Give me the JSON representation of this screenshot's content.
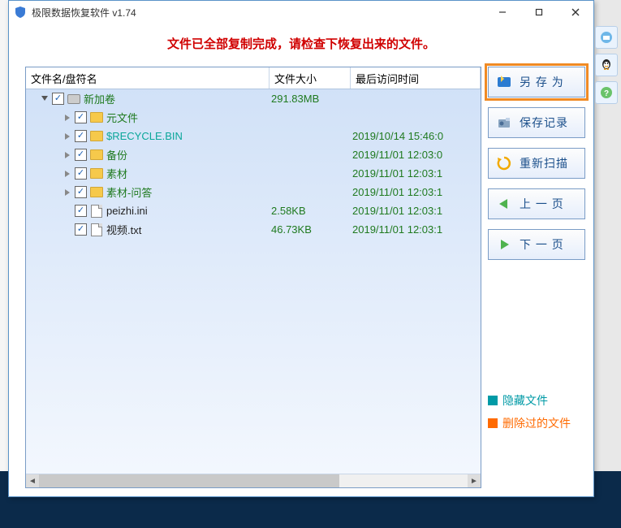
{
  "window": {
    "title": "极限数据恢复软件 v1.74"
  },
  "banner": "文件已全部复制完成，请检查下恢复出来的文件。",
  "columns": {
    "name": "文件名/盘符名",
    "size": "文件大小",
    "time": "最后访问时间"
  },
  "rows": [
    {
      "indent": 0,
      "expander": "down",
      "checked": true,
      "icon": "disk",
      "label": "新加卷",
      "labelClass": "",
      "size": "291.83MB",
      "time": ""
    },
    {
      "indent": 1,
      "expander": "right",
      "checked": true,
      "icon": "folder",
      "label": "元文件",
      "labelClass": "",
      "size": "",
      "time": ""
    },
    {
      "indent": 1,
      "expander": "right",
      "checked": true,
      "icon": "folder",
      "label": "$RECYCLE.BIN",
      "labelClass": "teal",
      "size": "",
      "time": "2019/10/14 15:46:0"
    },
    {
      "indent": 1,
      "expander": "right",
      "checked": true,
      "icon": "folder",
      "label": "备份",
      "labelClass": "",
      "size": "",
      "time": "2019/11/01 12:03:0"
    },
    {
      "indent": 1,
      "expander": "right",
      "checked": true,
      "icon": "folder",
      "label": "素材",
      "labelClass": "",
      "size": "",
      "time": "2019/11/01 12:03:1"
    },
    {
      "indent": 1,
      "expander": "right",
      "checked": true,
      "icon": "folder",
      "label": "素材-问答",
      "labelClass": "",
      "size": "",
      "time": "2019/11/01 12:03:1"
    },
    {
      "indent": 1,
      "expander": "",
      "checked": true,
      "icon": "file",
      "label": "peizhi.ini",
      "labelClass": "black",
      "size": "2.58KB",
      "time": "2019/11/01 12:03:1"
    },
    {
      "indent": 1,
      "expander": "",
      "checked": true,
      "icon": "file",
      "label": "视频.txt",
      "labelClass": "black",
      "size": "46.73KB",
      "time": "2019/11/01 12:03:1"
    }
  ],
  "buttons": {
    "save_as": "另 存 为",
    "save_log": "保存记录",
    "rescan": "重新扫描",
    "prev": "上 一 页",
    "next": "下 一 页"
  },
  "legend": {
    "hidden": "隐藏文件",
    "deleted": "删除过的文件"
  }
}
